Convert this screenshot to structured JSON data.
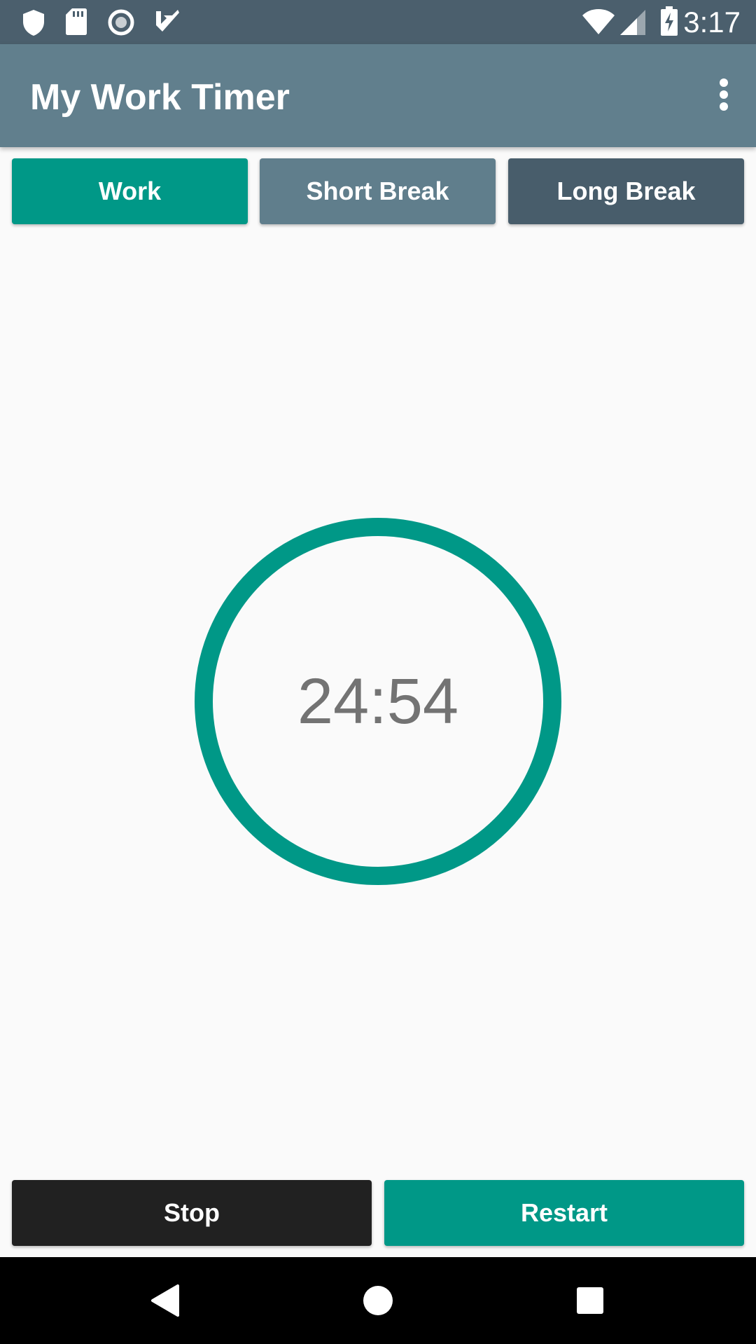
{
  "status_bar": {
    "time": "3:17",
    "left_icons": [
      "shield-icon",
      "sd-card-icon",
      "circle-record-icon",
      "task-check-icon"
    ],
    "right_icons": [
      "wifi-icon",
      "cellular-signal-icon",
      "battery-charging-icon"
    ]
  },
  "app_bar": {
    "title": "My Work Timer",
    "overflow_icon": "more-vert-icon"
  },
  "modes": [
    {
      "label": "Work",
      "color": "#009887"
    },
    {
      "label": "Short Break",
      "color": "#607e8c"
    },
    {
      "label": "Long Break",
      "color": "#485d6b"
    }
  ],
  "timer": {
    "display": "24:54",
    "ring_color": "#009887",
    "text_color": "#737373"
  },
  "controls": {
    "stop_label": "Stop",
    "restart_label": "Restart"
  },
  "nav_bar": {
    "icons": [
      "back-icon",
      "home-icon",
      "recents-icon"
    ]
  },
  "colors": {
    "status_bar": "#4b5f6d",
    "app_bar": "#617f8d",
    "background": "#fafafa",
    "accent": "#009887",
    "stop": "#212121"
  }
}
